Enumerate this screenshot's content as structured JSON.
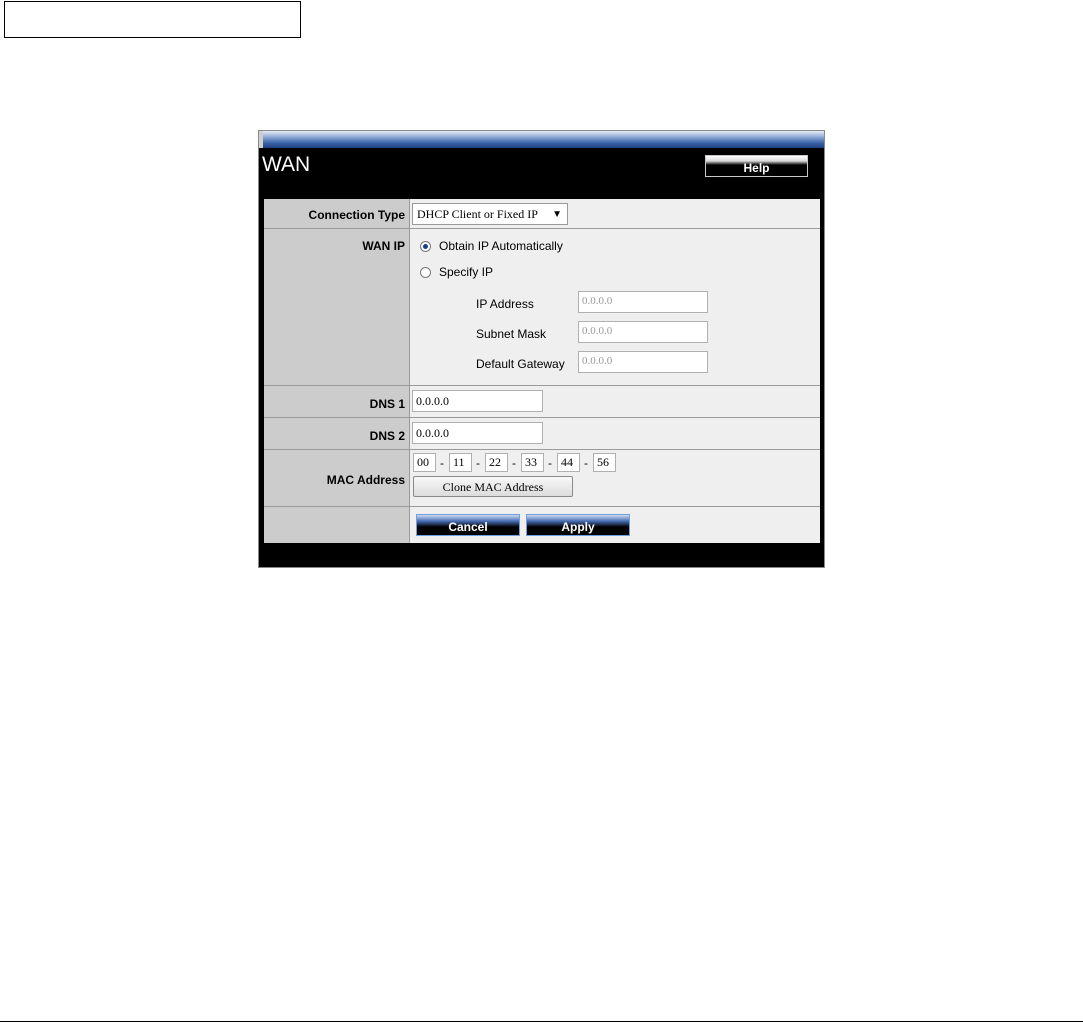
{
  "panel": {
    "title": "WAN",
    "help_label": "Help"
  },
  "connection_type": {
    "label": "Connection Type",
    "selected": "DHCP Client or Fixed IP"
  },
  "wan_ip": {
    "label": "WAN IP",
    "option_auto": "Obtain IP Automatically",
    "option_specify": "Specify IP",
    "ip_address_label": "IP Address",
    "ip_address_value": "0.0.0.0",
    "subnet_mask_label": "Subnet Mask",
    "subnet_mask_value": "0.0.0.0",
    "gateway_label": "Default Gateway",
    "gateway_value": "0.0.0.0"
  },
  "dns1": {
    "label": "DNS 1",
    "value": "0.0.0.0"
  },
  "dns2": {
    "label": "DNS 2",
    "value": "0.0.0.0"
  },
  "mac": {
    "label": "MAC Address",
    "octets": [
      "00",
      "11",
      "22",
      "33",
      "44",
      "56"
    ],
    "separator": "-",
    "clone_label": "Clone MAC Address"
  },
  "actions": {
    "cancel_label": "Cancel",
    "apply_label": "Apply"
  },
  "colors": {
    "label_bg": "#cccccc",
    "value_bg": "#efefef",
    "panel_bg": "#000000",
    "accent": "#3a63a8"
  }
}
